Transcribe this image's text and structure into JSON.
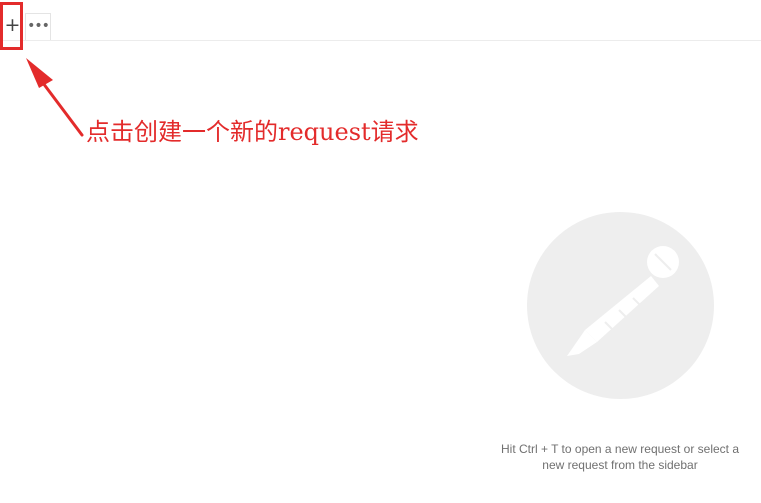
{
  "tabbar": {
    "new_tab_label": "+",
    "more_label": "•••"
  },
  "annotation": {
    "text": "点击创建一个新的request请求",
    "color": "#e32b2b"
  },
  "empty_state": {
    "hint_line1": "Hit Ctrl + T to open a new request or select a",
    "hint_line2": "new request from the sidebar",
    "logo_icon": "postman-rocket-icon"
  }
}
